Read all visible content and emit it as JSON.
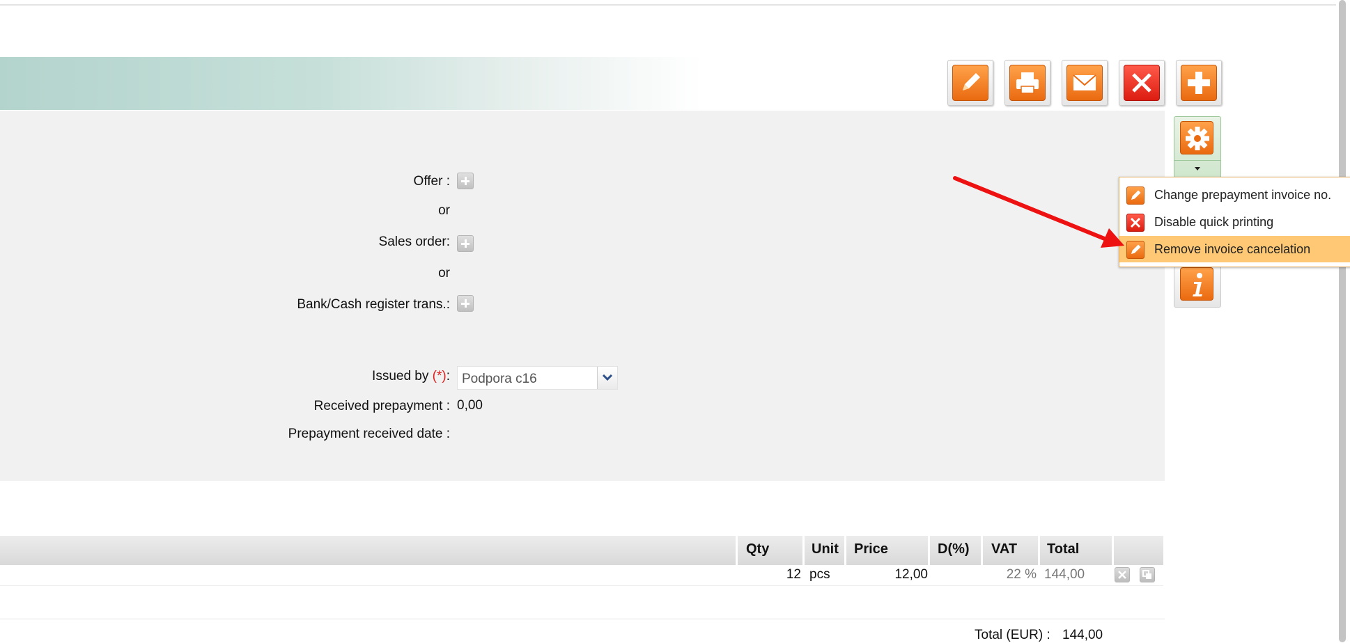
{
  "toolbar": {
    "buttons": [
      {
        "name": "edit-button",
        "icon": "pencil-icon"
      },
      {
        "name": "print-button",
        "icon": "printer-icon"
      },
      {
        "name": "email-button",
        "icon": "envelope-icon"
      },
      {
        "name": "cancel-button",
        "icon": "close-icon"
      },
      {
        "name": "add-button",
        "icon": "plus-icon"
      }
    ],
    "settings_icon": "gear-icon",
    "info_icon": "info-icon"
  },
  "form": {
    "offer_label": "Offer :",
    "or1": "or",
    "sales_order_label": "Sales order:",
    "or2": "or",
    "bank_label": "Bank/Cash register trans.:",
    "issued_by_label": "Issued by ",
    "required_mark": "(*)",
    "issued_by_colon": ":",
    "issued_by_value": "Podpora c16",
    "received_prepayment_label": "Received prepayment :",
    "received_prepayment_value": "0,00",
    "prepayment_date_label": "Prepayment received date :"
  },
  "dropdown": {
    "items": [
      {
        "label": "Change prepayment invoice no.",
        "icon": "pencil-icon"
      },
      {
        "label": "Disable quick printing",
        "icon": "close-icon"
      },
      {
        "label": "Remove invoice cancelation",
        "icon": "pencil-icon",
        "highlighted": true
      }
    ]
  },
  "table": {
    "headers": [
      "Qty",
      "Unit",
      "Price",
      "D(%)",
      "VAT",
      "Total"
    ],
    "rows": [
      {
        "qty": "12",
        "unit": "pcs",
        "price": "12,00",
        "discount": "",
        "vat": "22 %",
        "total": "144,00"
      }
    ]
  },
  "footer": {
    "total_label": "Total (EUR) :",
    "total_value": "144,00"
  },
  "colors": {
    "accent_orange": "#f07a1e",
    "accent_red": "#e0251a",
    "highlight": "#ffc874",
    "annotation_arrow": "#ee1111"
  }
}
